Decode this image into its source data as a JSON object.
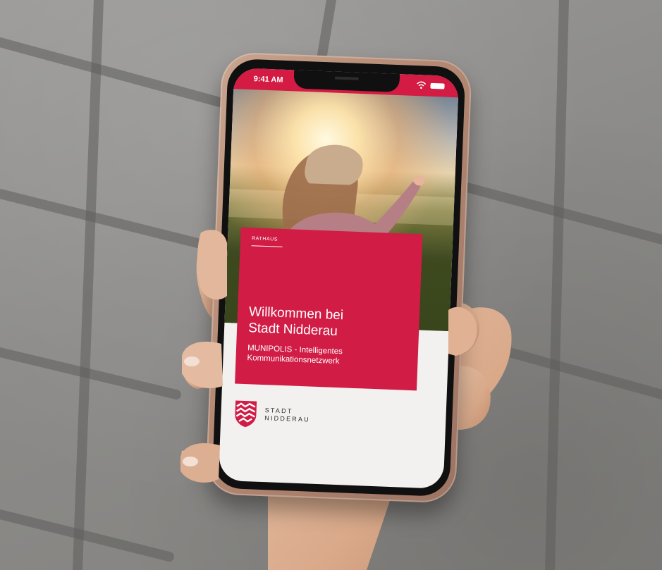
{
  "status_bar": {
    "time": "9:41 AM",
    "icons": [
      "wifi-icon",
      "battery-icon"
    ],
    "color": "#d31b43"
  },
  "hero": {
    "category": "RATHAUS",
    "title_line1": "Willkommen bei",
    "title_line2": "Stadt Nidderau",
    "subtitle_line1": "MUNIPOLIS - Intelligentes",
    "subtitle_line2": "Kommunikationsnetzwerk",
    "card_color": "#d11c45"
  },
  "footer": {
    "logo_line1": "STADT",
    "logo_line2": "NIDDERAU",
    "logo_icon": "coat-of-arms-icon"
  }
}
